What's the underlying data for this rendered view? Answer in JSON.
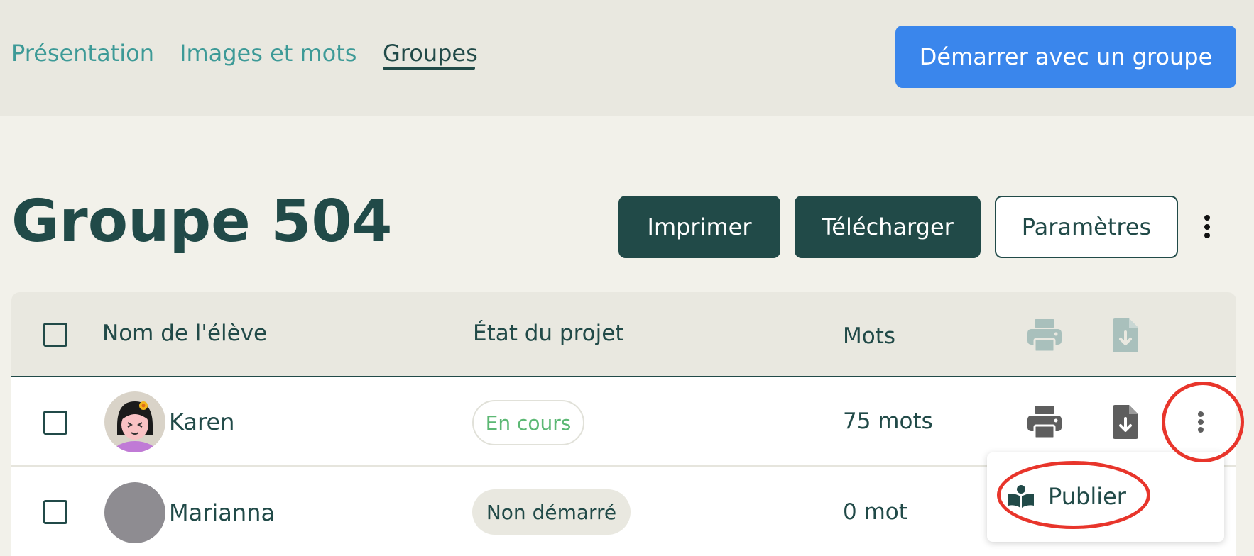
{
  "nav": {
    "tabs": [
      {
        "label": "Présentation"
      },
      {
        "label": "Images et mots"
      },
      {
        "label": "Groupes"
      }
    ],
    "start_button": "Démarrer avec un groupe"
  },
  "header": {
    "title": "Groupe 504",
    "print_button": "Imprimer",
    "download_button": "Télécharger",
    "settings_button": "Paramètres"
  },
  "table": {
    "columns": {
      "name": "Nom de l'élève",
      "status": "État du projet",
      "words": "Mots"
    },
    "rows": [
      {
        "name": "Karen",
        "status": "En cours",
        "words": "75 mots"
      },
      {
        "name": "Marianna",
        "status": "Non démarré",
        "words": "0 mot"
      }
    ]
  },
  "row_menu": {
    "items": [
      {
        "label": "Publier",
        "icon": "open-book-icon"
      }
    ]
  },
  "colors": {
    "primary_dark": "#214a48",
    "accent_blue": "#3a86ec",
    "link_teal": "#3d9a97",
    "status_green": "#5cb874",
    "annotation_red": "#e8352b"
  }
}
